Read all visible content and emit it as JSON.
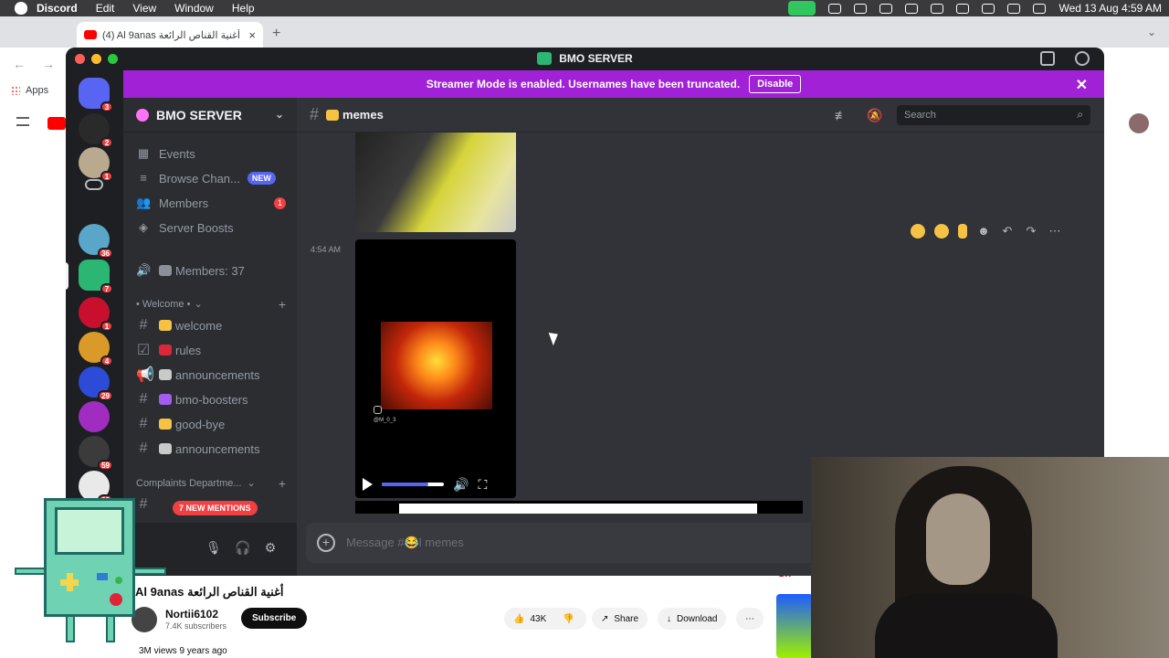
{
  "menubar": {
    "app_name": "Discord",
    "items": [
      "Edit",
      "View",
      "Window",
      "Help"
    ],
    "clock": "Wed 13 Aug  4:59 AM"
  },
  "browser": {
    "tab_title": "(4) Al 9anas أغنية القناص الرائعة",
    "bookmarks_label": "Apps"
  },
  "discord": {
    "window_title": "BMO SERVER",
    "streamer_banner": {
      "text": "Streamer Mode is enabled. Usernames have been truncated.",
      "button": "Disable"
    },
    "servers": [
      {
        "badge": "3"
      },
      {
        "badge": "2"
      },
      {
        "badge": "1"
      },
      {
        "badge": ""
      },
      {
        "badge": "36"
      },
      {
        "badge": "7"
      },
      {
        "badge": "1"
      },
      {
        "badge": "4"
      },
      {
        "badge": "29"
      },
      {
        "badge": ""
      },
      {
        "badge": "59"
      },
      {
        "badge": "38"
      }
    ],
    "sidebar": {
      "server_name": "BMO SERVER",
      "nav": [
        {
          "label": "Events"
        },
        {
          "label": "Browse Chan...",
          "badge": "NEW"
        },
        {
          "label": "Members",
          "count": "1"
        },
        {
          "label": "Server Boosts"
        }
      ],
      "voice_members": "Members: 37",
      "category_welcome": "• Welcome •",
      "channels": [
        {
          "name": "welcome",
          "emoji_color": "#f6c244"
        },
        {
          "name": "rules",
          "emoji_color": "#d9283a"
        },
        {
          "name": "announcements",
          "emoji_color": "#c9c9c9"
        },
        {
          "name": "bmo-boosters",
          "emoji_color": "#a35cf0"
        },
        {
          "name": "good-bye",
          "emoji_color": "#f6c244"
        },
        {
          "name": "announcements",
          "emoji_color": "#c9c9c9"
        }
      ],
      "category_complaints": "Complaints Departme...",
      "mentions": "7 NEW MENTIONS"
    },
    "chat": {
      "channel_name": "memes",
      "search_placeholder": "Search",
      "timestamp": "4:54 AM",
      "video_handle": "@M_0_3",
      "video_progress": 0.75,
      "composer_placeholder": "Message #😂l memes"
    },
    "colors": {
      "blurple": "#5865f2",
      "streamer_bg": "#a021d6",
      "danger": "#f23f42"
    }
  },
  "youtube": {
    "video_title": "Al 9anas أغنية القناص الرائعة",
    "channel": "Nortii6102",
    "subscribers": "7.4K subscribers",
    "subscribe_label": "Subscribe",
    "likes": "43K",
    "share_label": "Share",
    "download_label": "Download",
    "stats": "3M views  9 years ago",
    "right_tag": "Sh"
  }
}
